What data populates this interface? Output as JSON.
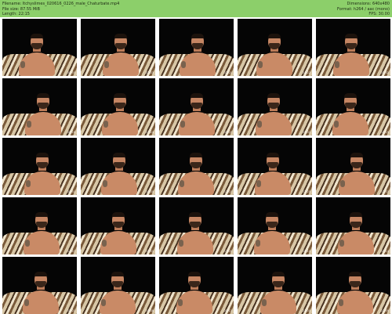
{
  "header": {
    "filename": "Filename: Itchyslimes_020616_0226_male_Chaturbate.mp4",
    "filesize": "File size: 87.55 MiB",
    "length": "Length: 22:15",
    "dimensions": "Dimensions: 640x480",
    "format": "Format: h264 / aac (mono)",
    "fps": "FPS: 30.00"
  },
  "colors": {
    "header_bg": "#8ccf6a",
    "frame_bg": "#050505"
  },
  "thumbnails": [
    {
      "timestamp": "00:55"
    },
    {
      "timestamp": "02:03"
    },
    {
      "timestamp": "03:21"
    },
    {
      "timestamp": "04:22"
    },
    {
      "timestamp": "05:32"
    },
    {
      "timestamp": "06:16"
    },
    {
      "timestamp": "07:24"
    },
    {
      "timestamp": "08:37"
    },
    {
      "timestamp": "09:31"
    },
    {
      "timestamp": "10:19"
    },
    {
      "timestamp": "08:51"
    },
    {
      "timestamp": "10:00"
    },
    {
      "timestamp": "11:07"
    },
    {
      "timestamp": "12:25"
    },
    {
      "timestamp": "13:37"
    },
    {
      "timestamp": "14:47"
    },
    {
      "timestamp": "15:51"
    },
    {
      "timestamp": "17:05"
    },
    {
      "timestamp": "18:10"
    },
    {
      "timestamp": "19:14"
    },
    {
      "timestamp": "18:21"
    },
    {
      "timestamp": "19:08"
    },
    {
      "timestamp": "20:13"
    },
    {
      "timestamp": "21:00"
    },
    {
      "timestamp": "21:59"
    }
  ]
}
